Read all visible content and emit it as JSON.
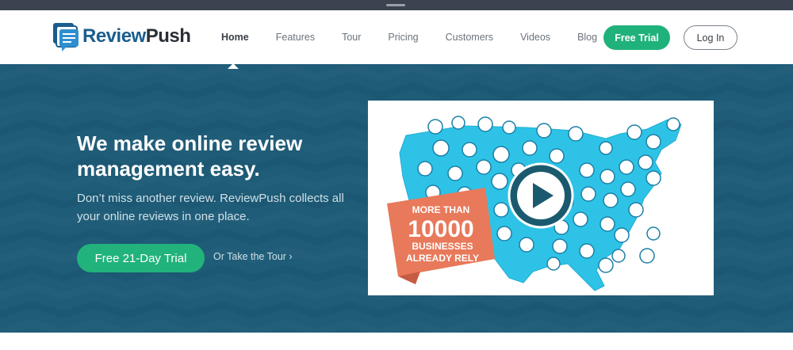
{
  "brand": {
    "name_part1": "Review",
    "name_part2": "Push"
  },
  "nav": {
    "items": [
      {
        "label": "Home",
        "active": true
      },
      {
        "label": "Features",
        "active": false
      },
      {
        "label": "Tour",
        "active": false
      },
      {
        "label": "Pricing",
        "active": false
      },
      {
        "label": "Customers",
        "active": false
      },
      {
        "label": "Videos",
        "active": false
      },
      {
        "label": "Blog",
        "active": false
      }
    ],
    "free_trial_label": "Free Trial",
    "login_label": "Log In"
  },
  "hero": {
    "headline": "We make online review management easy.",
    "subtext": "Don’t miss another review. ReviewPush collects all your online reviews in one place.",
    "cta_label": "Free 21-Day Trial",
    "tour_label": "Or Take the Tour ›"
  },
  "video": {
    "banner_line1": "MORE THAN",
    "banner_number": "10000",
    "banner_line2": "BUSINESSES",
    "banner_line3": "ALREADY RELY"
  },
  "colors": {
    "brand_blue": "#1a5d8f",
    "hero_bg": "#1f5e79",
    "accent_green": "#1fb27a",
    "map_cyan": "#2ec3e6",
    "banner_orange": "#e8795a"
  }
}
